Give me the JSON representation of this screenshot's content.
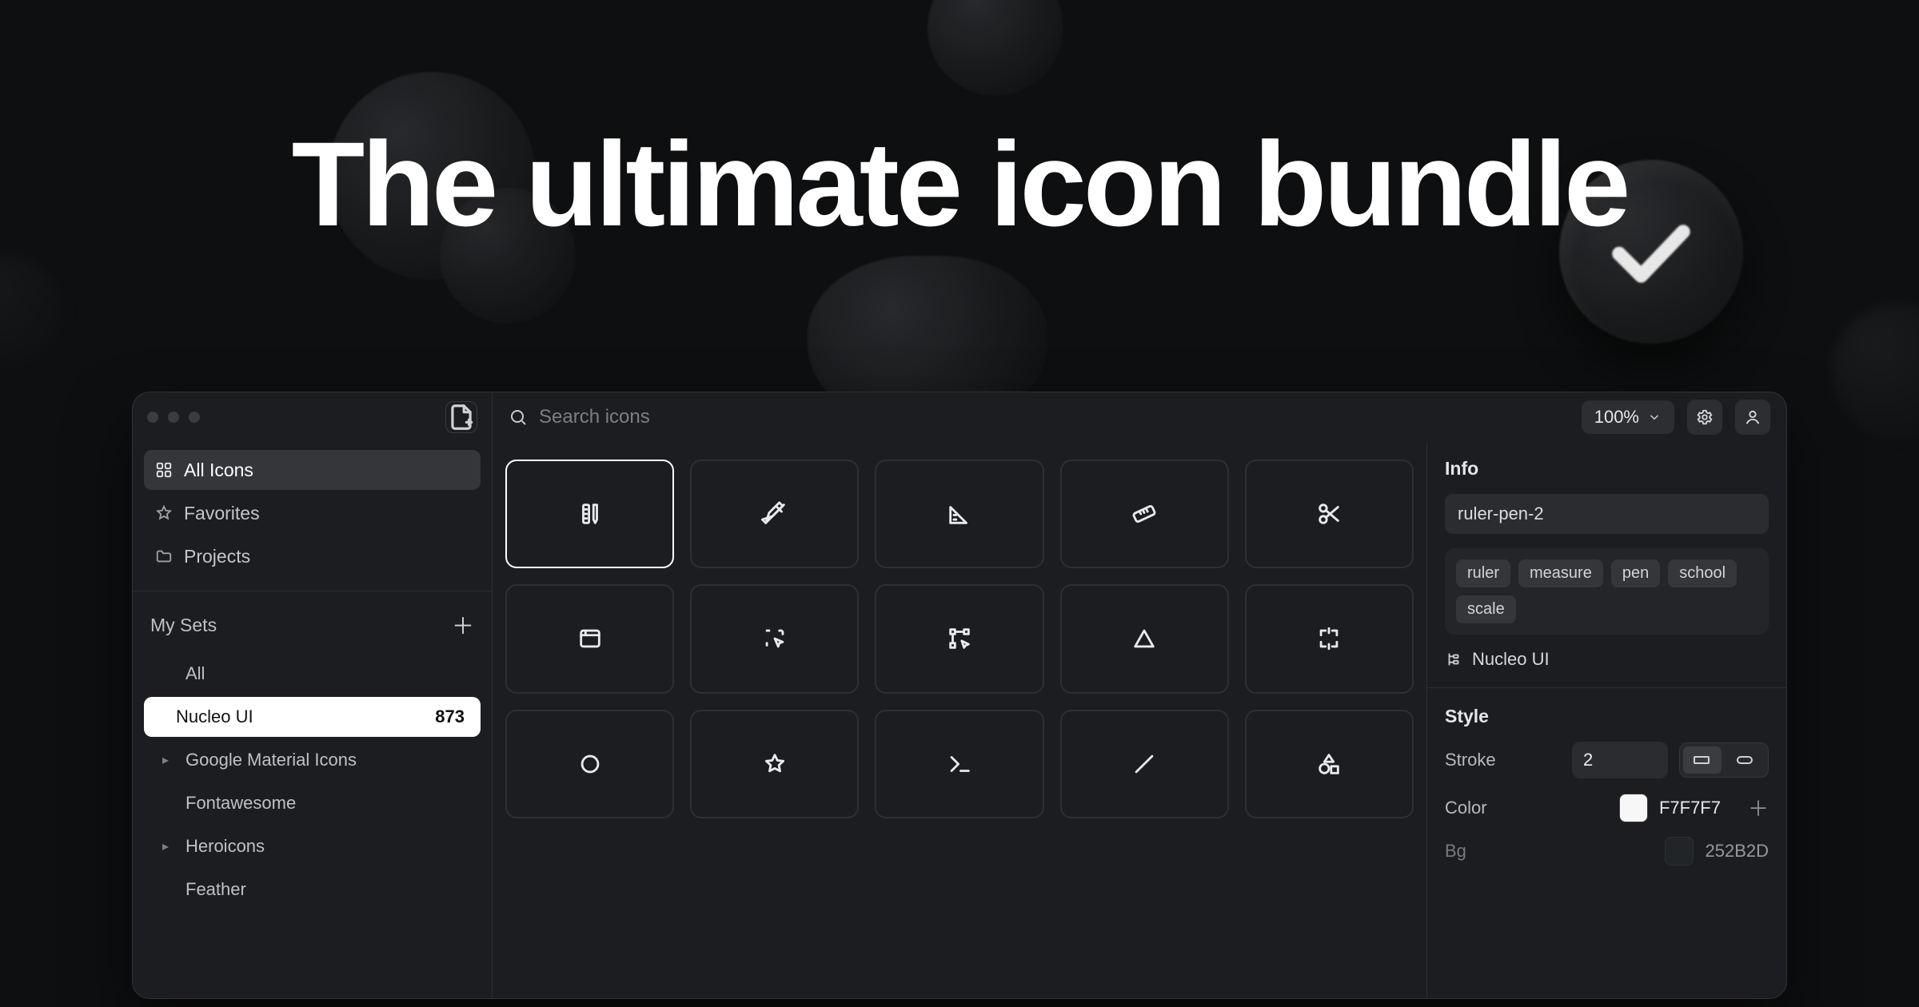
{
  "hero": {
    "title": "The ultimate icon bundle"
  },
  "search": {
    "placeholder": "Search icons"
  },
  "zoom": {
    "level": "100%"
  },
  "sidebar": {
    "nav": [
      {
        "label": "All Icons",
        "icon": "grid-icon",
        "active": true
      },
      {
        "label": "Favorites",
        "icon": "star-icon",
        "active": false
      },
      {
        "label": "Projects",
        "icon": "folder-icon",
        "active": false
      }
    ],
    "setsHeader": "My Sets",
    "sets": [
      {
        "label": "All",
        "chevron": false,
        "selected": false
      },
      {
        "label": "Nucleo UI",
        "chevron": false,
        "selected": true,
        "count": "873"
      },
      {
        "label": "Google Material Icons",
        "chevron": true,
        "selected": false
      },
      {
        "label": "Fontawesome",
        "chevron": false,
        "selected": false
      },
      {
        "label": "Heroicons",
        "chevron": true,
        "selected": false
      },
      {
        "label": "Feather",
        "chevron": false,
        "selected": false
      }
    ]
  },
  "grid": {
    "selectedIndex": 0,
    "icons": [
      "ruler-pen-icon",
      "pencil-ruler-icon",
      "ruler-triangle-icon",
      "ruler-icon",
      "scissors-icon",
      "browser-icon",
      "select-area-icon",
      "select-nodes-icon",
      "triangle-icon",
      "crop-expand-icon",
      "circle-icon",
      "star-outline-icon",
      "terminal-icon",
      "line-icon",
      "shapes-icon"
    ]
  },
  "info": {
    "title": "Info",
    "name": "ruler-pen-2",
    "tags": [
      "ruler",
      "measure",
      "pen",
      "school",
      "scale"
    ],
    "iconset": "Nucleo UI",
    "styleTitle": "Style",
    "strokeLabel": "Stroke",
    "strokeValue": "2",
    "colorLabel": "Color",
    "colorHex": "F7F7F7",
    "colorSwatch": "#f7f7f7",
    "bgLabel": "Bg",
    "bgHex": "252B2D",
    "bgSwatch": "#252b2d"
  }
}
